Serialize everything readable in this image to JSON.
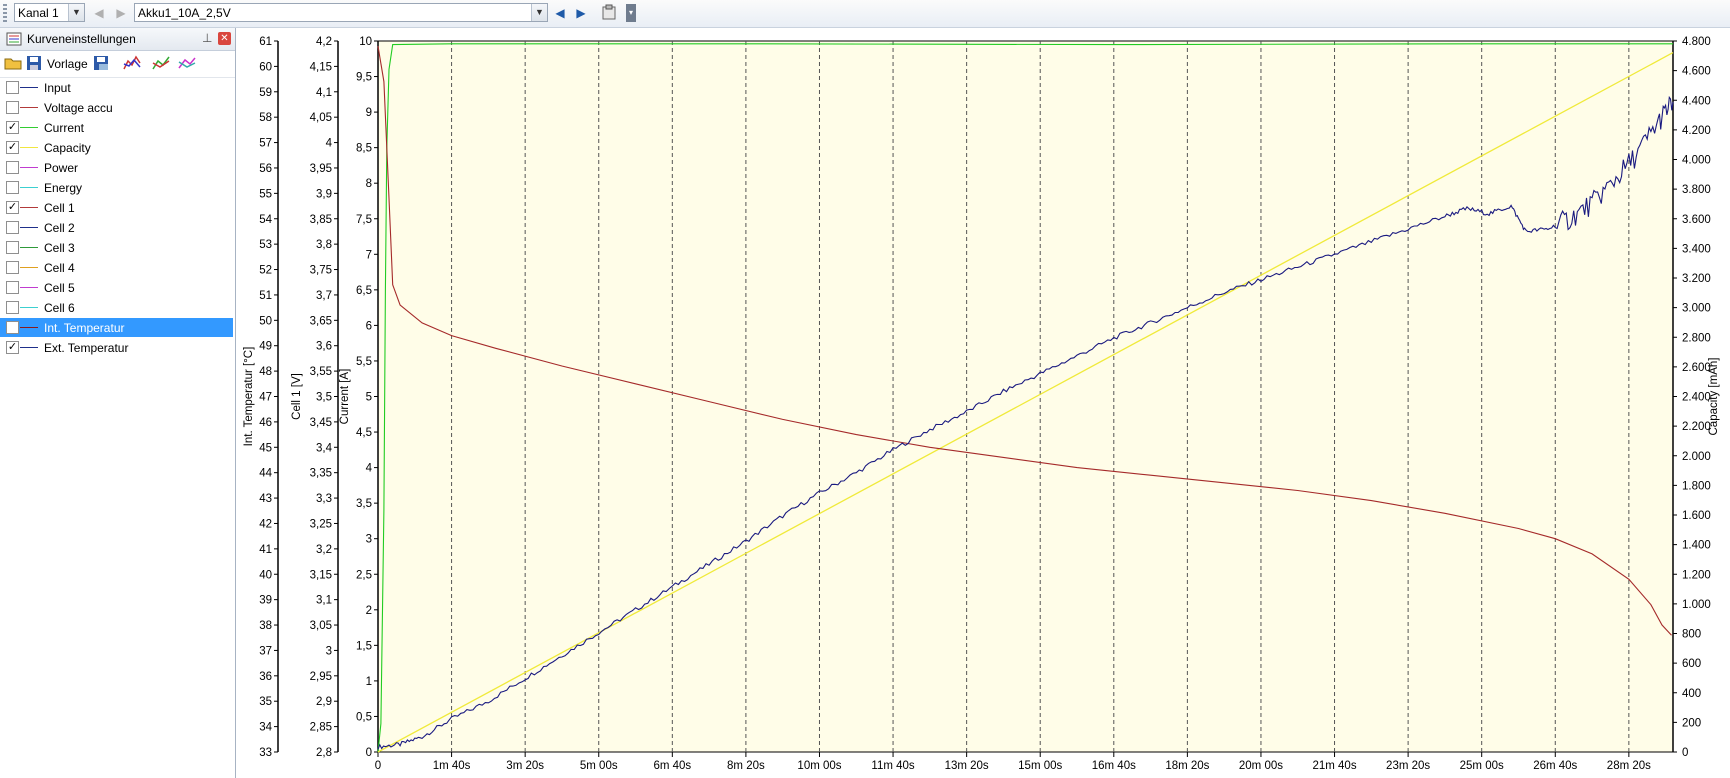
{
  "toolbar": {
    "channel": "Kanal 1",
    "file": "Akku1_10A_2,5V"
  },
  "panel": {
    "title": "Kurveneinstellungen",
    "template_label": "Vorlage",
    "curves": [
      {
        "label": "Input",
        "checked": false,
        "color": "#1f2f8a"
      },
      {
        "label": "Voltage accu",
        "checked": false,
        "color": "#b23a3a"
      },
      {
        "label": "Current",
        "checked": true,
        "color": "#32cd32"
      },
      {
        "label": "Capacity",
        "checked": true,
        "color": "#f0e640"
      },
      {
        "label": "Power",
        "checked": false,
        "color": "#c03ccf"
      },
      {
        "label": "Energy",
        "checked": false,
        "color": "#3cd0d0"
      },
      {
        "label": "Cell 1",
        "checked": true,
        "color": "#b23a3a"
      },
      {
        "label": "Cell 2",
        "checked": false,
        "color": "#1f2f8a"
      },
      {
        "label": "Cell 3",
        "checked": false,
        "color": "#2e9a3a"
      },
      {
        "label": "Cell 4",
        "checked": false,
        "color": "#e0a020"
      },
      {
        "label": "Cell 5",
        "checked": false,
        "color": "#c03ccf"
      },
      {
        "label": "Cell 6",
        "checked": false,
        "color": "#3cd0d0"
      },
      {
        "label": "Int. Temperatur",
        "checked": false,
        "color": "#8b1a1a",
        "selected": true
      },
      {
        "label": "Ext. Temperatur",
        "checked": true,
        "color": "#1f2f8a"
      }
    ]
  },
  "chart_data": {
    "type": "line",
    "x_ticks": [
      "0",
      "1m 40s",
      "3m 20s",
      "5m 00s",
      "6m 40s",
      "8m 20s",
      "10m 00s",
      "11m 40s",
      "13m 20s",
      "15m 00s",
      "16m 40s",
      "18m 20s",
      "20m 00s",
      "21m 40s",
      "23m 20s",
      "25m 00s",
      "26m 40s",
      "28m 20s"
    ],
    "x_seconds": [
      0,
      100,
      200,
      300,
      400,
      500,
      600,
      700,
      800,
      900,
      1000,
      1100,
      1200,
      1300,
      1400,
      1500,
      1600,
      1700
    ],
    "xlim": [
      0,
      1760
    ],
    "axes": [
      {
        "title": "Int. Temperatur [°C]",
        "range": [
          33,
          61
        ],
        "ticks": [
          "33",
          "34",
          "35",
          "36",
          "37",
          "38",
          "39",
          "40",
          "41",
          "42",
          "43",
          "44",
          "45",
          "46",
          "47",
          "48",
          "49",
          "50",
          "51",
          "52",
          "53",
          "54",
          "55",
          "56",
          "57",
          "58",
          "59",
          "60",
          "61"
        ]
      },
      {
        "title": "Cell 1 [V]",
        "range": [
          2.8,
          4.2
        ],
        "ticks": [
          "2,8",
          "2,85",
          "2,9",
          "2,95",
          "3",
          "3,05",
          "3,1",
          "3,15",
          "3,2",
          "3,25",
          "3,3",
          "3,35",
          "3,4",
          "3,45",
          "3,5",
          "3,55",
          "3,6",
          "3,65",
          "3,7",
          "3,75",
          "3,8",
          "3,85",
          "3,9",
          "3,95",
          "4",
          "4,05",
          "4,1",
          "4,15",
          "4,2"
        ]
      },
      {
        "title": "Current [A]",
        "range": [
          0,
          10
        ],
        "ticks": [
          "0",
          "0,5",
          "1",
          "1,5",
          "2",
          "2,5",
          "3",
          "3,5",
          "4",
          "4,5",
          "5",
          "5,5",
          "6",
          "6,5",
          "7",
          "7,5",
          "8",
          "8,5",
          "9",
          "9,5",
          "10"
        ]
      },
      {
        "title": "Capacity [mAh]",
        "range": [
          0,
          4900
        ],
        "ticks": [
          "0",
          "200",
          "400",
          "600",
          "800",
          "1.000",
          "1.200",
          "1.400",
          "1.600",
          "1.800",
          "2.000",
          "2.200",
          "2.400",
          "2.600",
          "2.800",
          "3.000",
          "3.200",
          "3.400",
          "3.600",
          "3.800",
          "4.000",
          "4.200",
          "4.400",
          "4.600",
          "4.800"
        ]
      }
    ],
    "series": [
      {
        "name": "Current",
        "axis": "Current [A]",
        "color": "#22cc22",
        "points": [
          [
            0,
            0
          ],
          [
            4,
            0.4
          ],
          [
            8,
            3.4
          ],
          [
            10,
            6.5
          ],
          [
            12,
            8.5
          ],
          [
            15,
            9.6
          ],
          [
            20,
            9.95
          ],
          [
            100,
            9.96
          ],
          [
            500,
            9.96
          ],
          [
            1000,
            9.95
          ],
          [
            1500,
            9.96
          ],
          [
            1760,
            9.96
          ]
        ]
      },
      {
        "name": "Capacity",
        "axis": "Capacity [mAh]",
        "color": "#f0ea3a",
        "points": [
          [
            0,
            0
          ],
          [
            1760,
            4820
          ]
        ]
      },
      {
        "name": "Cell 1",
        "axis": "Cell 1 [V]",
        "color": "#a52a2a",
        "points": [
          [
            0,
            4.19
          ],
          [
            8,
            4.12
          ],
          [
            15,
            3.89
          ],
          [
            20,
            3.72
          ],
          [
            30,
            3.68
          ],
          [
            60,
            3.645
          ],
          [
            100,
            3.62
          ],
          [
            160,
            3.595
          ],
          [
            250,
            3.56
          ],
          [
            350,
            3.525
          ],
          [
            450,
            3.49
          ],
          [
            550,
            3.455
          ],
          [
            650,
            3.425
          ],
          [
            750,
            3.4
          ],
          [
            850,
            3.38
          ],
          [
            950,
            3.36
          ],
          [
            1050,
            3.345
          ],
          [
            1150,
            3.33
          ],
          [
            1250,
            3.315
          ],
          [
            1350,
            3.295
          ],
          [
            1450,
            3.27
          ],
          [
            1550,
            3.24
          ],
          [
            1600,
            3.22
          ],
          [
            1650,
            3.19
          ],
          [
            1700,
            3.14
          ],
          [
            1730,
            3.09
          ],
          [
            1745,
            3.05
          ],
          [
            1758,
            3.03
          ]
        ]
      },
      {
        "name": "Ext. Temperatur",
        "axis": "Int. Temperatur [°C]",
        "color": "#1a1a80",
        "points": [
          [
            0,
            33.2
          ],
          [
            30,
            33.3
          ],
          [
            60,
            33.6
          ],
          [
            100,
            34.3
          ],
          [
            150,
            35.0
          ],
          [
            200,
            35.9
          ],
          [
            250,
            36.8
          ],
          [
            300,
            37.7
          ],
          [
            350,
            38.6
          ],
          [
            400,
            39.5
          ],
          [
            450,
            40.4
          ],
          [
            500,
            41.3
          ],
          [
            550,
            42.3
          ],
          [
            600,
            43.2
          ],
          [
            650,
            44.0
          ],
          [
            700,
            44.9
          ],
          [
            750,
            45.7
          ],
          [
            800,
            46.4
          ],
          [
            850,
            47.2
          ],
          [
            900,
            47.9
          ],
          [
            950,
            48.6
          ],
          [
            1000,
            49.3
          ],
          [
            1050,
            49.9
          ],
          [
            1100,
            50.5
          ],
          [
            1150,
            51.1
          ],
          [
            1200,
            51.6
          ],
          [
            1250,
            52.1
          ],
          [
            1300,
            52.6
          ],
          [
            1350,
            53.1
          ],
          [
            1400,
            53.6
          ],
          [
            1450,
            54.1
          ],
          [
            1480,
            54.4
          ],
          [
            1510,
            54.2
          ],
          [
            1540,
            54.5
          ],
          [
            1560,
            53.5
          ],
          [
            1590,
            53.6
          ],
          [
            1620,
            54.0
          ],
          [
            1650,
            54.6
          ],
          [
            1680,
            55.5
          ],
          [
            1710,
            56.5
          ],
          [
            1740,
            57.8
          ],
          [
            1760,
            58.6
          ]
        ]
      }
    ]
  }
}
